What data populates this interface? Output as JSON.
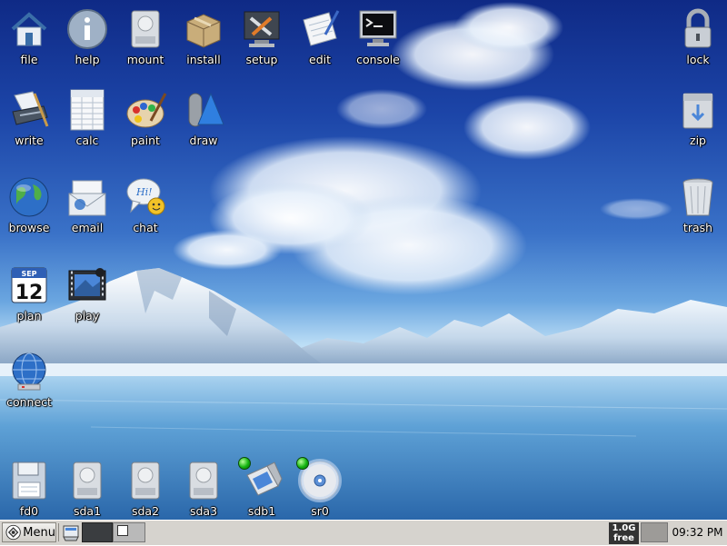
{
  "desktop": {
    "top_row": [
      {
        "id": "file",
        "label": "file",
        "icon": "home-icon"
      },
      {
        "id": "help",
        "label": "help",
        "icon": "info-icon"
      },
      {
        "id": "mount",
        "label": "mount",
        "icon": "drive-icon"
      },
      {
        "id": "install",
        "label": "install",
        "icon": "package-icon"
      },
      {
        "id": "setup",
        "label": "setup",
        "icon": "tools-icon"
      },
      {
        "id": "edit",
        "label": "edit",
        "icon": "notepad-icon"
      },
      {
        "id": "console",
        "label": "console",
        "icon": "terminal-icon"
      }
    ],
    "row2": [
      {
        "id": "write",
        "label": "write",
        "icon": "typewriter-icon"
      },
      {
        "id": "calc",
        "label": "calc",
        "icon": "spreadsheet-icon"
      },
      {
        "id": "paint",
        "label": "paint",
        "icon": "palette-icon"
      },
      {
        "id": "draw",
        "label": "draw",
        "icon": "shapes-icon"
      }
    ],
    "row3": [
      {
        "id": "browse",
        "label": "browse",
        "icon": "globe-icon"
      },
      {
        "id": "email",
        "label": "email",
        "icon": "envelope-icon"
      },
      {
        "id": "chat",
        "label": "chat",
        "icon": "chat-bubble-icon"
      }
    ],
    "row4": [
      {
        "id": "plan",
        "label": "plan",
        "icon": "calendar-icon",
        "calendar_month": "SEP",
        "calendar_day": "12"
      },
      {
        "id": "play",
        "label": "play",
        "icon": "film-icon"
      }
    ],
    "connect": {
      "label": "connect",
      "icon": "network-globe-icon"
    },
    "right": [
      {
        "id": "lock",
        "label": "lock",
        "icon": "padlock-icon"
      },
      {
        "id": "zip",
        "label": "zip",
        "icon": "archive-icon"
      },
      {
        "id": "trash",
        "label": "trash",
        "icon": "trash-can-icon"
      }
    ],
    "drives": [
      {
        "id": "fd0",
        "label": "fd0",
        "icon": "floppy-icon",
        "mounted": false
      },
      {
        "id": "sda1",
        "label": "sda1",
        "icon": "hard-drive-icon",
        "mounted": false
      },
      {
        "id": "sda2",
        "label": "sda2",
        "icon": "hard-drive-icon",
        "mounted": false
      },
      {
        "id": "sda3",
        "label": "sda3",
        "icon": "hard-drive-icon",
        "mounted": false
      },
      {
        "id": "sdb1",
        "label": "sdb1",
        "icon": "usb-stick-icon",
        "mounted": true
      },
      {
        "id": "sr0",
        "label": "sr0",
        "icon": "cd-rom-icon",
        "mounted": true
      }
    ]
  },
  "taskbar": {
    "menu_label": "Menu",
    "free_space_line1": "1.0G",
    "free_space_line2": "free",
    "clock": "09:32 PM"
  },
  "colors": {
    "taskbar_bg": "#d6d3ce",
    "mounted_led": "#13b40f"
  }
}
